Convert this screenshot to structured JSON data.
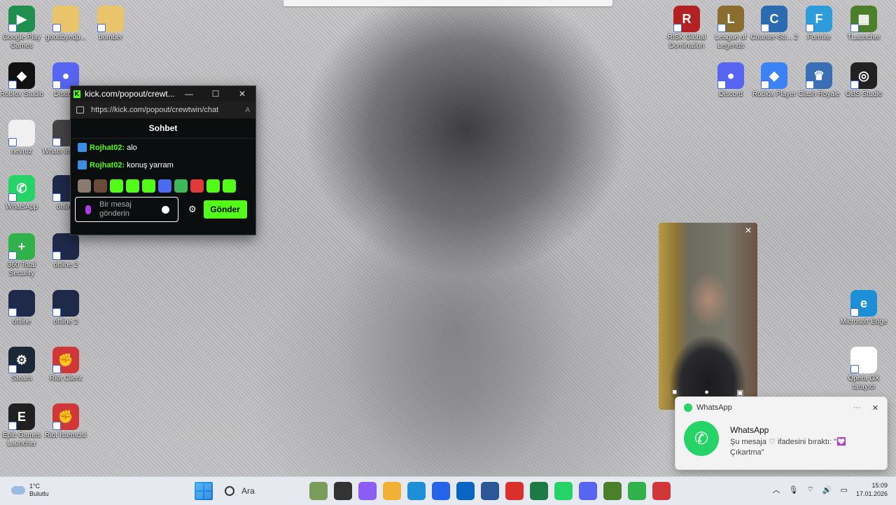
{
  "browser_top": {},
  "desktop_left": [
    {
      "label": "Google Play Games",
      "color": "#1f8f4e",
      "glyph": "▶",
      "icon": "google-play-games-icon"
    },
    {
      "label": "goodbyedp...",
      "color": "#e9c46a",
      "glyph": "",
      "icon": "folder-icon"
    },
    {
      "label": "bomber",
      "color": "#e9c46a",
      "glyph": "",
      "icon": "folder-icon"
    },
    {
      "label": "Roblox Studio",
      "color": "#111111",
      "glyph": "◆",
      "icon": "roblox-studio-icon"
    },
    {
      "label": "Discord",
      "color": "#5865f2",
      "glyph": "●",
      "icon": "discord-icon"
    },
    {
      "label": "nevruz",
      "color": "#f0f0f0",
      "glyph": "",
      "icon": "image-icon"
    },
    {
      "label": "Whats image...",
      "color": "#444444",
      "glyph": "",
      "icon": "image-icon"
    },
    {
      "label": "WhatsApp",
      "color": "#25d366",
      "glyph": "✆",
      "icon": "whatsapp-icon"
    },
    {
      "label": "offline",
      "color": "#1f2a4a",
      "glyph": "",
      "icon": "image-icon"
    },
    {
      "label": "360 Total Security",
      "color": "#2fb24a",
      "glyph": "+",
      "icon": "360-security-icon"
    },
    {
      "label": "offline 2",
      "color": "#1f2a4a",
      "glyph": "",
      "icon": "image-icon"
    },
    {
      "label": "offline",
      "color": "#1f2a4a",
      "glyph": "",
      "icon": "image-icon"
    },
    {
      "label": "offline 2",
      "color": "#1f2a4a",
      "glyph": "",
      "icon": "image-icon"
    },
    {
      "label": "Steam",
      "color": "#1b2838",
      "glyph": "⚙",
      "icon": "steam-icon"
    },
    {
      "label": "Riot Client",
      "color": "#d13639",
      "glyph": "✊",
      "icon": "riot-client-icon"
    },
    {
      "label": "Epic Games Launcher",
      "color": "#202020",
      "glyph": "E",
      "icon": "epic-games-icon"
    },
    {
      "label": "Riot İstemcisi",
      "color": "#d13639",
      "glyph": "✊",
      "icon": "riot-client-icon"
    }
  ],
  "desktop_right": [
    {
      "label": "RISK Global Domination",
      "color": "#b22222",
      "glyph": "R",
      "icon": "risk-icon"
    },
    {
      "label": "League of Legends",
      "color": "#8a6d2f",
      "glyph": "L",
      "icon": "league-of-legends-icon"
    },
    {
      "label": "Counter-Str... 2",
      "color": "#2b6cb0",
      "glyph": "C",
      "icon": "counter-strike-icon"
    },
    {
      "label": "Fortnite",
      "color": "#2d9cdb",
      "glyph": "F",
      "icon": "fortnite-icon"
    },
    {
      "label": "TLauncher",
      "color": "#4b7f2a",
      "glyph": "▦",
      "icon": "tlauncher-icon"
    },
    {
      "label": "Discord",
      "color": "#5865f2",
      "glyph": "●",
      "icon": "discord-icon"
    },
    {
      "label": "Roblox Player",
      "color": "#3b82f6",
      "glyph": "◆",
      "icon": "roblox-player-icon"
    },
    {
      "label": "Clash Royale",
      "color": "#3a6fb5",
      "glyph": "♛",
      "icon": "clash-royale-icon"
    },
    {
      "label": "OBS Studio",
      "color": "#222222",
      "glyph": "◎",
      "icon": "obs-studio-icon"
    },
    {
      "label": "Microsoft Edge",
      "color": "#1c8fd6",
      "glyph": "e",
      "icon": "edge-icon"
    },
    {
      "label": "Opera GX tarayıcı",
      "color": "#ffffff",
      "glyph": "O",
      "icon": "opera-gx-icon"
    }
  ],
  "chat_window": {
    "title": "kick.com/popout/crewt...",
    "url": "https://kick.com/popout/crewtwin/chat",
    "header": "Sohbet",
    "messages": [
      {
        "user": "Rojhat02:",
        "text": "alo"
      },
      {
        "user": "Rojhat02:",
        "text": "konuş yarram"
      }
    ],
    "emote_colors": [
      "#8a7a70",
      "#6b4a3a",
      "#53fc18",
      "#53fc18",
      "#53fc18",
      "#4a6cf0",
      "#3db85a",
      "#e03a3a",
      "#53fc18",
      "#53fc18"
    ],
    "input_placeholder": "Bir mesaj gönderin",
    "send_label": "Gönder"
  },
  "notification": {
    "app": "WhatsApp",
    "title": "WhatsApp",
    "text": "Şu mesaja ♡ ifadesini bıraktı: \"💟 Çıkartma\""
  },
  "taskbar": {
    "weather_temp": "1°C",
    "weather_desc": "Bulutlu",
    "search_label": "Ara",
    "time": "15:09",
    "date": "17.01.2026",
    "apps": [
      {
        "icon": "scenery-widget-icon",
        "color": "#7a9b5a"
      },
      {
        "icon": "terminal-icon",
        "color": "#333333"
      },
      {
        "icon": "copilot-icon",
        "color": "#8b5cf6"
      },
      {
        "icon": "file-explorer-icon",
        "color": "#f2b134"
      },
      {
        "icon": "edge-icon",
        "color": "#1c8fd6"
      },
      {
        "icon": "store-icon",
        "color": "#2563eb"
      },
      {
        "icon": "outlook-icon",
        "color": "#0a64c2"
      },
      {
        "icon": "word-icon",
        "color": "#2b5797"
      },
      {
        "icon": "pdf-icon",
        "color": "#d9302c"
      },
      {
        "icon": "excel-icon",
        "color": "#1d7a44"
      },
      {
        "icon": "whatsapp-icon",
        "color": "#25d366"
      },
      {
        "icon": "discord-icon",
        "color": "#5865f2"
      },
      {
        "icon": "minecraft-icon",
        "color": "#4b7f2a"
      },
      {
        "icon": "360-security-icon",
        "color": "#2fb24a"
      },
      {
        "icon": "riot-client-icon",
        "color": "#d13639"
      }
    ]
  }
}
